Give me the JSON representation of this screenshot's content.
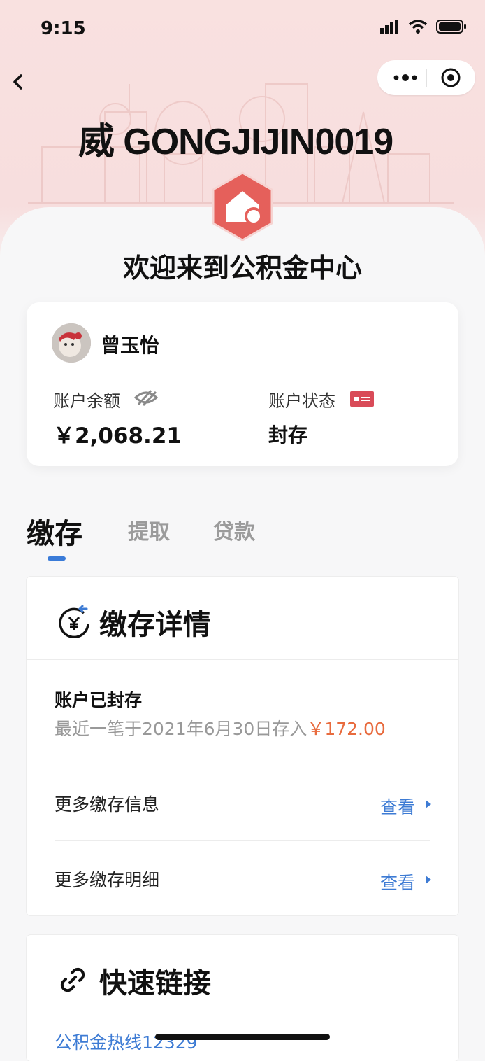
{
  "status_bar": {
    "time": "9:15"
  },
  "watermark": "威 GONGJIJIN0019",
  "welcome_title": "欢迎来到公积金中心",
  "account": {
    "name": "曾玉怡",
    "balance_label": "账户余额",
    "balance_value": "￥2,068.21",
    "status_label": "账户状态",
    "status_value": "封存"
  },
  "tabs": [
    {
      "label": "缴存",
      "active": true
    },
    {
      "label": "提取",
      "active": false
    },
    {
      "label": "贷款",
      "active": false
    }
  ],
  "deposit_details": {
    "title": "缴存详情",
    "status_title": "账户已封存",
    "recent_prefix": "最近一笔于2021年6月30日存入",
    "recent_amount": "￥172.00",
    "rows": [
      {
        "label": "更多缴存信息",
        "action": "查看"
      },
      {
        "label": "更多缴存明细",
        "action": "查看"
      }
    ]
  },
  "quick_links": {
    "title": "快速链接",
    "items": [
      "公积金热线12329"
    ]
  },
  "colors": {
    "accent_blue": "#3d7bd4",
    "logo_red": "#e5605b",
    "amount_orange": "#e86b3e",
    "hero_pink": "#f8e0df"
  },
  "icons": [
    "back-icon",
    "more-icon",
    "target-icon",
    "eye-off-icon",
    "id-card-icon",
    "yuan-refresh-icon",
    "chevron-right-icon",
    "link-icon"
  ]
}
